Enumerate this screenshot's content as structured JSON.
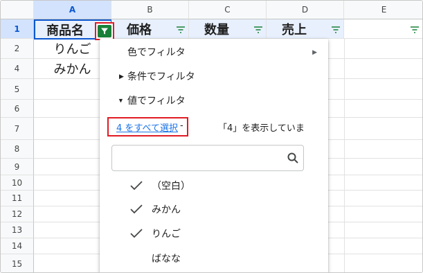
{
  "columns": [
    "A",
    "B",
    "C",
    "D",
    "E"
  ],
  "rows": [
    "1",
    "2",
    "4",
    "5",
    "6",
    "7",
    "8",
    "9",
    "10",
    "11",
    "12",
    "13",
    "14",
    "15"
  ],
  "headers": {
    "a": "商品名",
    "b": "価格",
    "c": "数量",
    "d": "売上"
  },
  "data": {
    "a2": "りんご",
    "a4": "みかん"
  },
  "menu": {
    "color_filter": "色でフィルタ",
    "condition_filter": "条件でフィルタ",
    "value_filter": "値でフィルタ",
    "select_all": "4 をすべて選択",
    "select_all_sep": "-",
    "showing": "「4」を表示していま"
  },
  "values": [
    {
      "label": "（空白）",
      "checked": true
    },
    {
      "label": "みかん",
      "checked": true
    },
    {
      "label": "りんご",
      "checked": true
    },
    {
      "label": "ばなな",
      "checked": false
    }
  ],
  "icons": {
    "filter": "filter-icon",
    "active_filter": "filter-active-icon",
    "search": "search-icon",
    "check": "check-icon"
  },
  "colors": {
    "selection_blue": "#0b57d0",
    "filter_green": "#188038",
    "highlight_red": "#e01b24",
    "link_blue": "#1a73e8"
  }
}
